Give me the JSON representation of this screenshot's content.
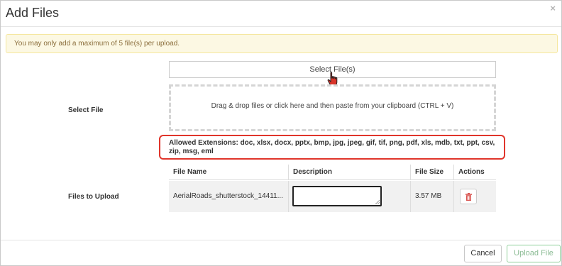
{
  "dialog": {
    "title": "Add Files",
    "close_glyph": "×"
  },
  "warning": {
    "text": "You may only add a maximum of 5 file(s) per upload."
  },
  "select_file": {
    "label": "Select File",
    "button_label": "Select File(s)",
    "dropzone_text": "Drag & drop files or click here and then paste from your clipboard (CTRL + V)",
    "allowed_extensions": "Allowed Extensions: doc, xlsx, docx, pptx, bmp, jpg, jpeg, gif, tif, png, pdf, xls, mdb, txt, ppt, csv, zip, msg, eml"
  },
  "files_to_upload": {
    "label": "Files to Upload",
    "columns": [
      "File Name",
      "Description",
      "File Size",
      "Actions"
    ],
    "rows": [
      {
        "file_name": "AerialRoads_shutterstock_14411...",
        "description": "",
        "file_size": "3.57 MB"
      }
    ]
  },
  "footer": {
    "cancel_label": "Cancel",
    "upload_label": "Upload File"
  },
  "colors": {
    "highlight_border": "#e0352b",
    "warning_bg": "#fcf8e3",
    "trash_icon": "#d9534f",
    "upload_border": "#8fcf99"
  },
  "icons": {
    "cursor": "hand-pointer-icon",
    "delete": "trash-icon",
    "close": "close-icon"
  }
}
